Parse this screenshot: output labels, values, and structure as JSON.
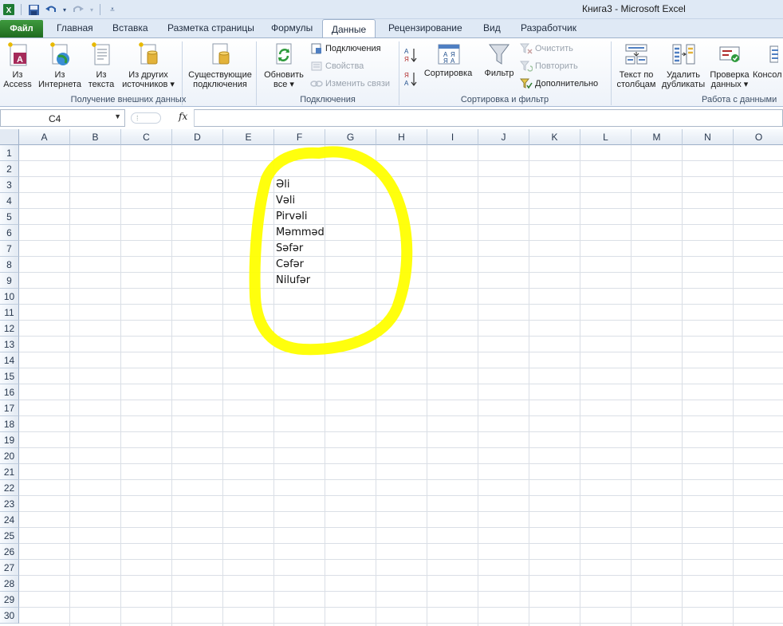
{
  "window": {
    "title": "Книга3  -  Microsoft Excel"
  },
  "qat": {
    "icons": [
      "excel-icon",
      "save-icon",
      "undo-icon",
      "redo-icon",
      "customize-icon"
    ]
  },
  "tabs": {
    "file": "Файл",
    "items": [
      "Главная",
      "Вставка",
      "Разметка страницы",
      "Формулы",
      "Данные",
      "Рецензирование",
      "Вид",
      "Разработчик"
    ],
    "active": "Данные"
  },
  "ribbon": {
    "groups": {
      "external": "Получение внешних данных",
      "connections": "Подключения",
      "sortfilter": "Сортировка и фильтр",
      "datatools": "Работа с данными"
    },
    "buttons": {
      "from_access_1": "Из",
      "from_access_2": "Access",
      "from_web_1": "Из",
      "from_web_2": "Интернета",
      "from_text_1": "Из",
      "from_text_2": "текста",
      "from_other_1": "Из других",
      "from_other_2": "источников ▾",
      "existing_1": "Существующие",
      "existing_2": "подключения",
      "refresh_1": "Обновить",
      "refresh_2": "все ▾",
      "connections": "Подключения",
      "properties": "Свойства",
      "edit_links": "Изменить связи",
      "sort": "Сортировка",
      "filter": "Фильтр",
      "clear": "Очистить",
      "reapply": "Повторить",
      "advanced": "Дополнительно",
      "text_to_cols_1": "Текст по",
      "text_to_cols_2": "столбцам",
      "remove_dups_1": "Удалить",
      "remove_dups_2": "дубликаты",
      "validation_1": "Проверка",
      "validation_2": "данных ▾",
      "consolidate_1": "Консол"
    }
  },
  "formula_bar": {
    "name_box": "C4",
    "fx": "fx",
    "value": ""
  },
  "columns": [
    "A",
    "B",
    "C",
    "D",
    "E",
    "F",
    "G",
    "H",
    "I",
    "J",
    "K",
    "L",
    "M",
    "N",
    "O"
  ],
  "rows": [
    "1",
    "2",
    "3",
    "4",
    "5",
    "6",
    "7",
    "8",
    "9",
    "10",
    "11",
    "12",
    "13",
    "14",
    "15",
    "16",
    "17",
    "18",
    "19",
    "20",
    "21",
    "22",
    "23",
    "24",
    "25",
    "26",
    "27",
    "28",
    "29",
    "30"
  ],
  "cells": {
    "F3": "Əli",
    "F4": "Vəli",
    "F5": "Pirvəli",
    "F6": "Məmməd",
    "F7": "Səfər",
    "F8": "Cəfər",
    "F9": "Nilufər"
  },
  "colors": {
    "highlight_marker": "#ffff00",
    "file_tab": "#2a7a2a"
  }
}
